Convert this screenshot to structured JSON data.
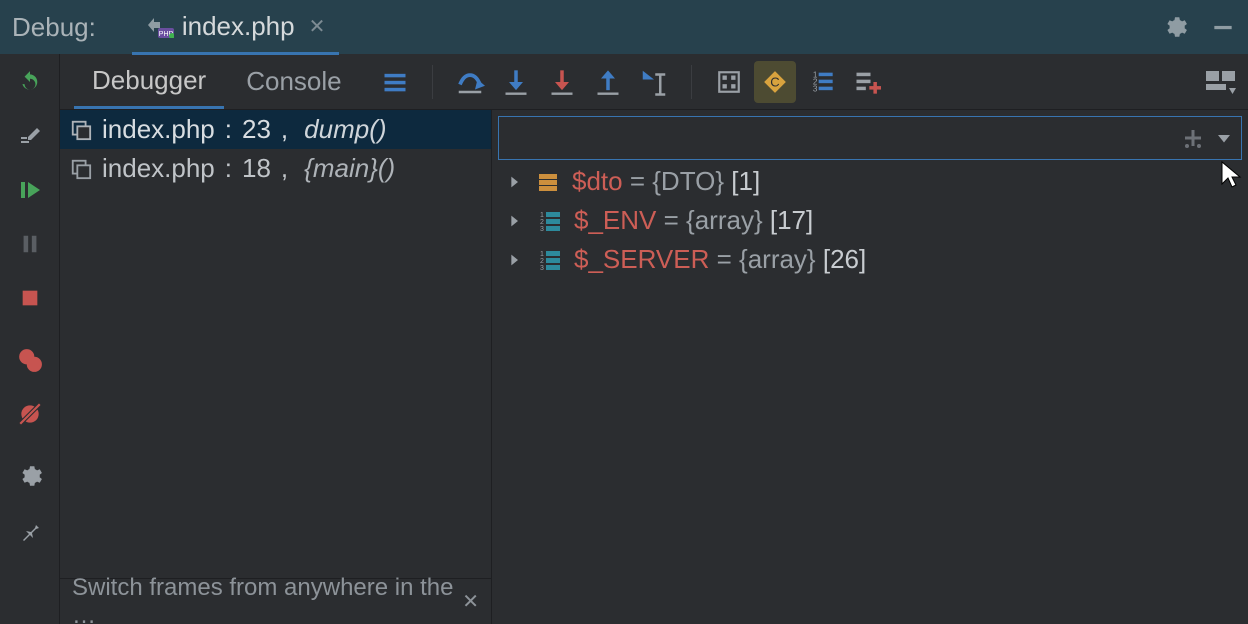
{
  "titlebar": {
    "label": "Debug:",
    "file_tab": "index.php"
  },
  "tabs": {
    "debugger": "Debugger",
    "console": "Console"
  },
  "frames": [
    {
      "file": "index.php",
      "line": "23",
      "call": "dump()"
    },
    {
      "file": "index.php",
      "line": "18",
      "call": "{main}()"
    }
  ],
  "tip": "Switch frames from anywhere in the …",
  "vars": [
    {
      "name": "$dto",
      "type": "{DTO}",
      "count": "[1]",
      "icon": "object"
    },
    {
      "name": "$_ENV",
      "type": "{array}",
      "count": "[17]",
      "icon": "array"
    },
    {
      "name": "$_SERVER",
      "type": "{array}",
      "count": "[26]",
      "icon": "array"
    }
  ],
  "sep": ":",
  "comma": ",",
  "eq": " = "
}
